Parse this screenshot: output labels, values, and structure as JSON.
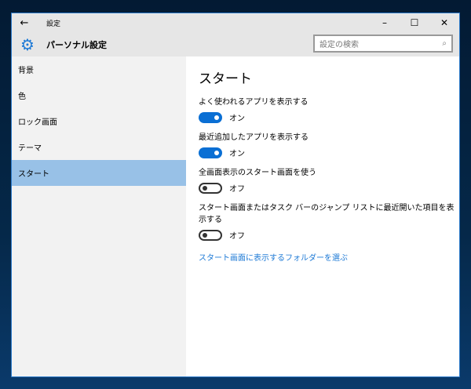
{
  "window": {
    "title": "設定",
    "back": "←",
    "minimize": "–",
    "maximize": "☐",
    "close": "✕"
  },
  "header": {
    "title": "パーソナル設定",
    "search_placeholder": "設定の検索",
    "search_icon": "⌕"
  },
  "sidebar": {
    "items": [
      {
        "label": "背景"
      },
      {
        "label": "色"
      },
      {
        "label": "ロック画面"
      },
      {
        "label": "テーマ"
      },
      {
        "label": "スタート",
        "selected": true
      }
    ]
  },
  "main": {
    "title": "スタート",
    "settings": [
      {
        "label": "よく使われるアプリを表示する",
        "state": "オン",
        "on": true
      },
      {
        "label": "最近追加したアプリを表示する",
        "state": "オン",
        "on": true
      },
      {
        "label": "全画面表示のスタート画面を使う",
        "state": "オフ",
        "on": false
      },
      {
        "label": "スタート画面またはタスク バーのジャンプ リストに最近開いた項目を表示する",
        "state": "オフ",
        "on": false
      }
    ],
    "link": "スタート画面に表示するフォルダーを選ぶ"
  },
  "colors": {
    "accent": "#0a6fd4",
    "selected": "#98c1e7"
  }
}
